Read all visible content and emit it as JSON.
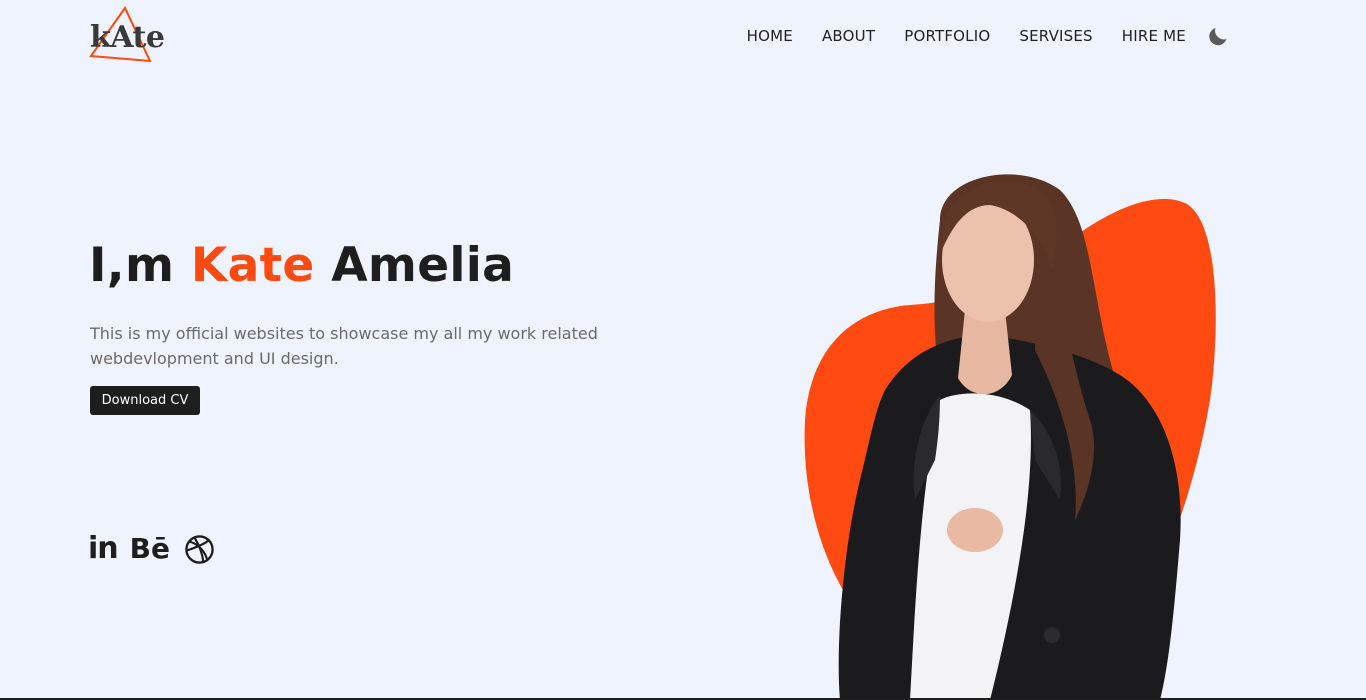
{
  "header": {
    "logo_text": "kAte",
    "nav": [
      {
        "label": "HOME"
      },
      {
        "label": "ABOUT"
      },
      {
        "label": "PORTFOLIO"
      },
      {
        "label": "SERVISES"
      },
      {
        "label": "HIRE ME"
      }
    ],
    "theme_icon": "moon-icon"
  },
  "hero": {
    "title_part1": "I,m ",
    "title_accent": "Kate",
    "title_part2": " Amelia",
    "description": "This is my official websites to showcase my all my work related webdevlopment and UI design.",
    "cv_button_label": "Download CV"
  },
  "social": {
    "linkedin_text": "in",
    "behance_text": "Bē",
    "icons": [
      "linkedin-icon",
      "behance-icon",
      "dribbble-icon"
    ]
  },
  "colors": {
    "accent": "#ff4a12",
    "background": "#eff3fd",
    "dark": "#1e1e1e",
    "text_muted": "#6b6b6b"
  }
}
